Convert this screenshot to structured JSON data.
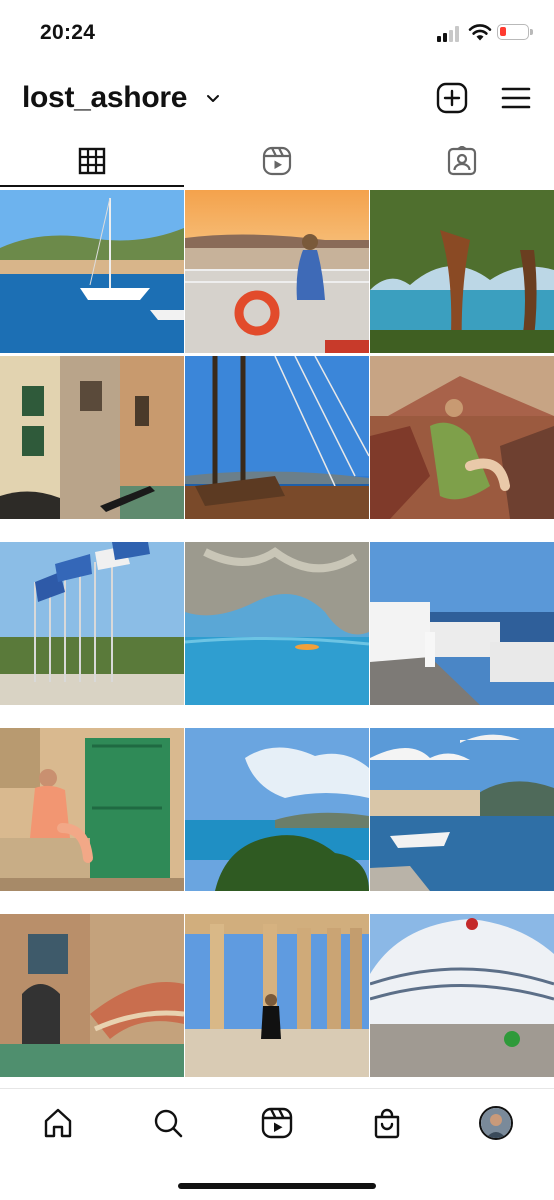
{
  "status": {
    "time": "20:24"
  },
  "profile": {
    "username": "lost_ashore"
  },
  "icons": {
    "create": "plus-square-icon",
    "menu": "hamburger-menu-icon",
    "dropdown": "chevron-down-icon",
    "tabs": [
      "grid-icon",
      "reels-icon",
      "tagged-icon"
    ],
    "nav": [
      "home-icon",
      "search-icon",
      "reels-icon",
      "shop-icon",
      "profile-avatar"
    ]
  },
  "tabs": {
    "selected": "grid"
  },
  "grid": {
    "columns": 3,
    "rows": 5,
    "posts": [
      "harbor-sailboats",
      "sunset-ship-deck",
      "pine-trees-coast",
      "venice-canal",
      "ship-rigging",
      "book-stairs-cafe",
      "greek-flags",
      "sea-cave-lagoon",
      "santorini-street",
      "green-door-venice",
      "coastal-cliff-view",
      "harbor-boats-town",
      "venice-bridge",
      "acropolis-columns",
      "cruise-ship-port"
    ]
  },
  "colors": {
    "accent": "#111111",
    "battery_low": "#ff3b30",
    "divider": "#e6e6e6"
  }
}
